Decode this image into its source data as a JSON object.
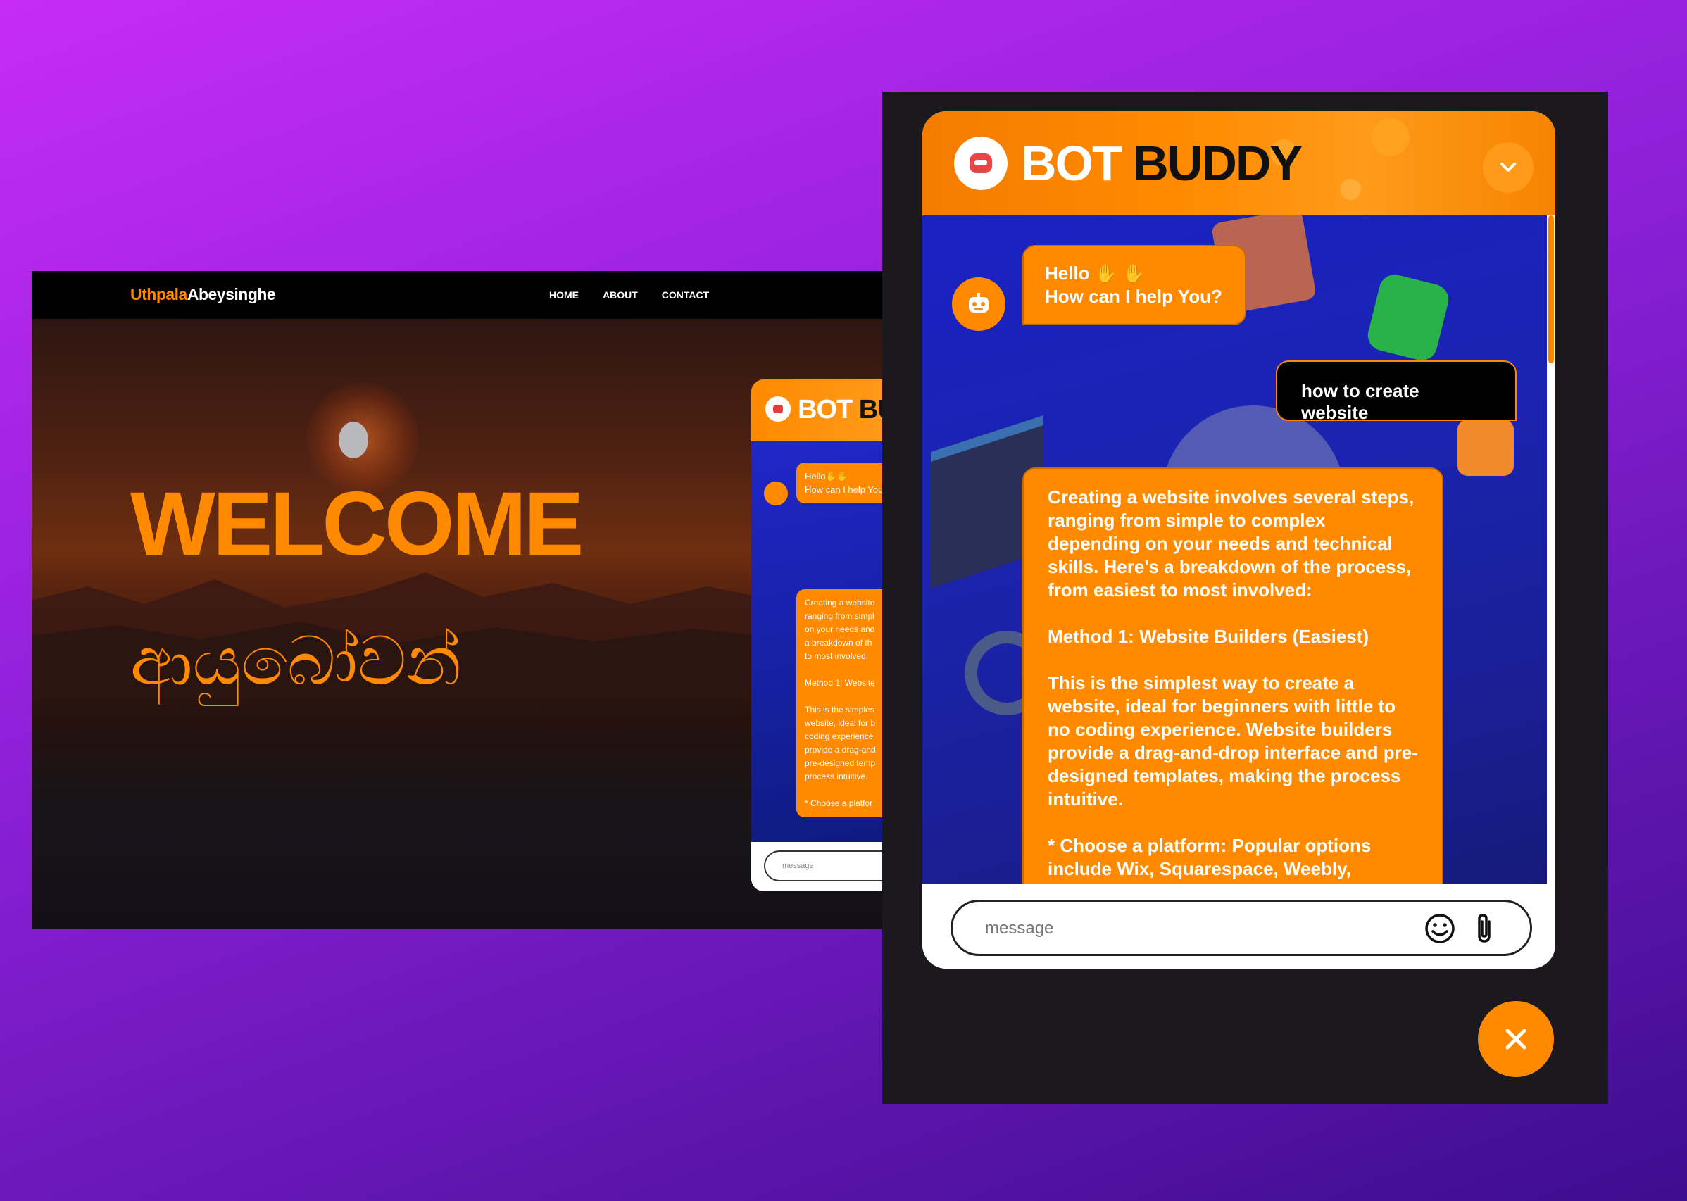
{
  "site": {
    "brand_first": "Uthpala",
    "brand_last": "Abeysinghe",
    "nav": [
      "HOME",
      "ABOUT",
      "CONTACT"
    ],
    "hero_title": "WELCOME",
    "hero_subtitle": "ආයුබෝවන්"
  },
  "mini_chat": {
    "title_a": "BOT",
    "title_b": "BUD",
    "greeting": "Hello✋✋\nHow can I help You",
    "reply_excerpt": "Creating a website\nranging from simpl\non your needs and\na breakdown of th\nto most involved:\n\nMethod 1: Website\n\nThis is the simples\nwebsite, ideal for b\ncoding experience\nprovide a drag-and\npre-designed temp\nprocess intuitive.\n\n* Choose a platfor",
    "input_placeholder": "message"
  },
  "chat": {
    "title_a": "BOT",
    "title_b": "BUDDY",
    "greeting_line1": "Hello ✋ ✋",
    "greeting_line2": "How can I help You?",
    "user_message": "how to create website",
    "bot_reply": "Creating a website involves several steps, ranging from simple to complex depending on your needs and technical skills. Here's a breakdown of the process, from easiest to most involved:\n\nMethod 1: Website Builders (Easiest)\n\nThis is the simplest way to create a website, ideal for beginners with little to no coding experience. Website builders provide a drag-and-drop interface and pre-designed templates, making the process intuitive.\n\n* Choose a platform: Popular options include Wix, Squarespace, Weebly,",
    "input_placeholder": "message"
  },
  "colors": {
    "accent": "#ff8a00",
    "chat_body": "#1a22c4",
    "background_top": "#c62cf6",
    "background_bottom": "#3d0d8f"
  },
  "icons": [
    "robot-icon",
    "chevron-down-icon",
    "smiley-icon",
    "paperclip-icon",
    "close-icon"
  ]
}
